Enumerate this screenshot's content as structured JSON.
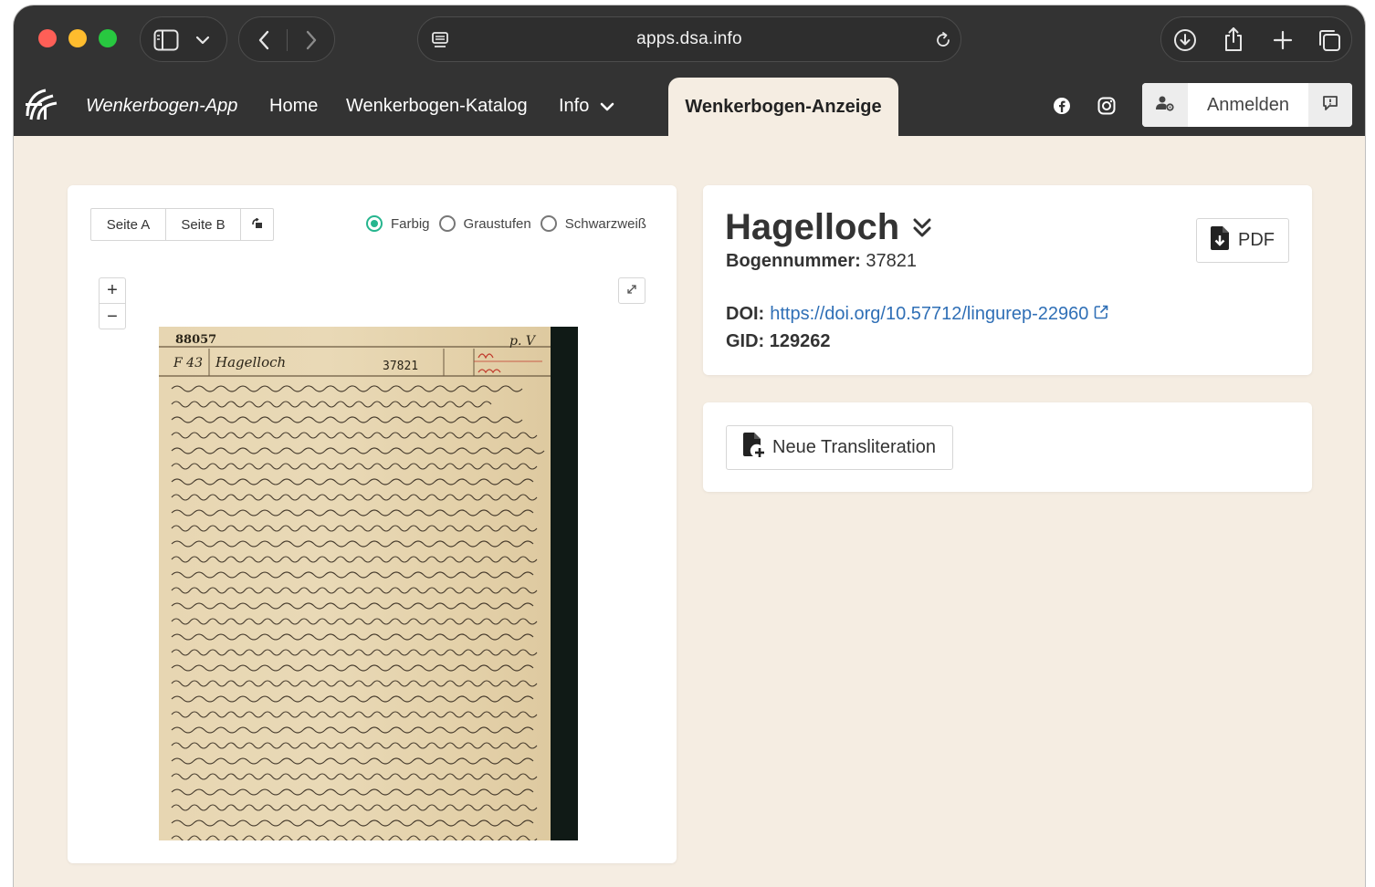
{
  "browser": {
    "url": "apps.dsa.info"
  },
  "navbar": {
    "brand": "Wenkerbogen-App",
    "home": "Home",
    "katalog": "Wenkerbogen-Katalog",
    "info": "Info",
    "active_tab": "Wenkerbogen-Anzeige",
    "login": "Anmelden"
  },
  "viewer": {
    "page_a": "Seite A",
    "page_b": "Seite B",
    "color_modes": [
      {
        "label": "Farbig",
        "checked": true
      },
      {
        "label": "Graustufen",
        "checked": false
      },
      {
        "label": "Schwarzweiß",
        "checked": false
      }
    ],
    "zoom_in": "+",
    "zoom_out": "−",
    "scan": {
      "archive_number": "88057",
      "place_code": "F 43",
      "place_written": "Hagelloch",
      "sheet_number": "37821",
      "corner_note": "p. V"
    }
  },
  "info": {
    "title": "Hagelloch",
    "bogen_label": "Bogennummer:",
    "bogen_value": "37821",
    "pdf_label": "PDF",
    "doi_label": "DOI:",
    "doi_value": "https://doi.org/10.57712/lingurep-22960",
    "gid_label": "GID:",
    "gid_value": "129262"
  },
  "translit": {
    "button_label": "Neue Transliteration"
  },
  "colors": {
    "chrome": "#333333",
    "page_bg": "#f5ede2",
    "radio_accent": "#26b58e",
    "link": "#2f6fb6"
  }
}
